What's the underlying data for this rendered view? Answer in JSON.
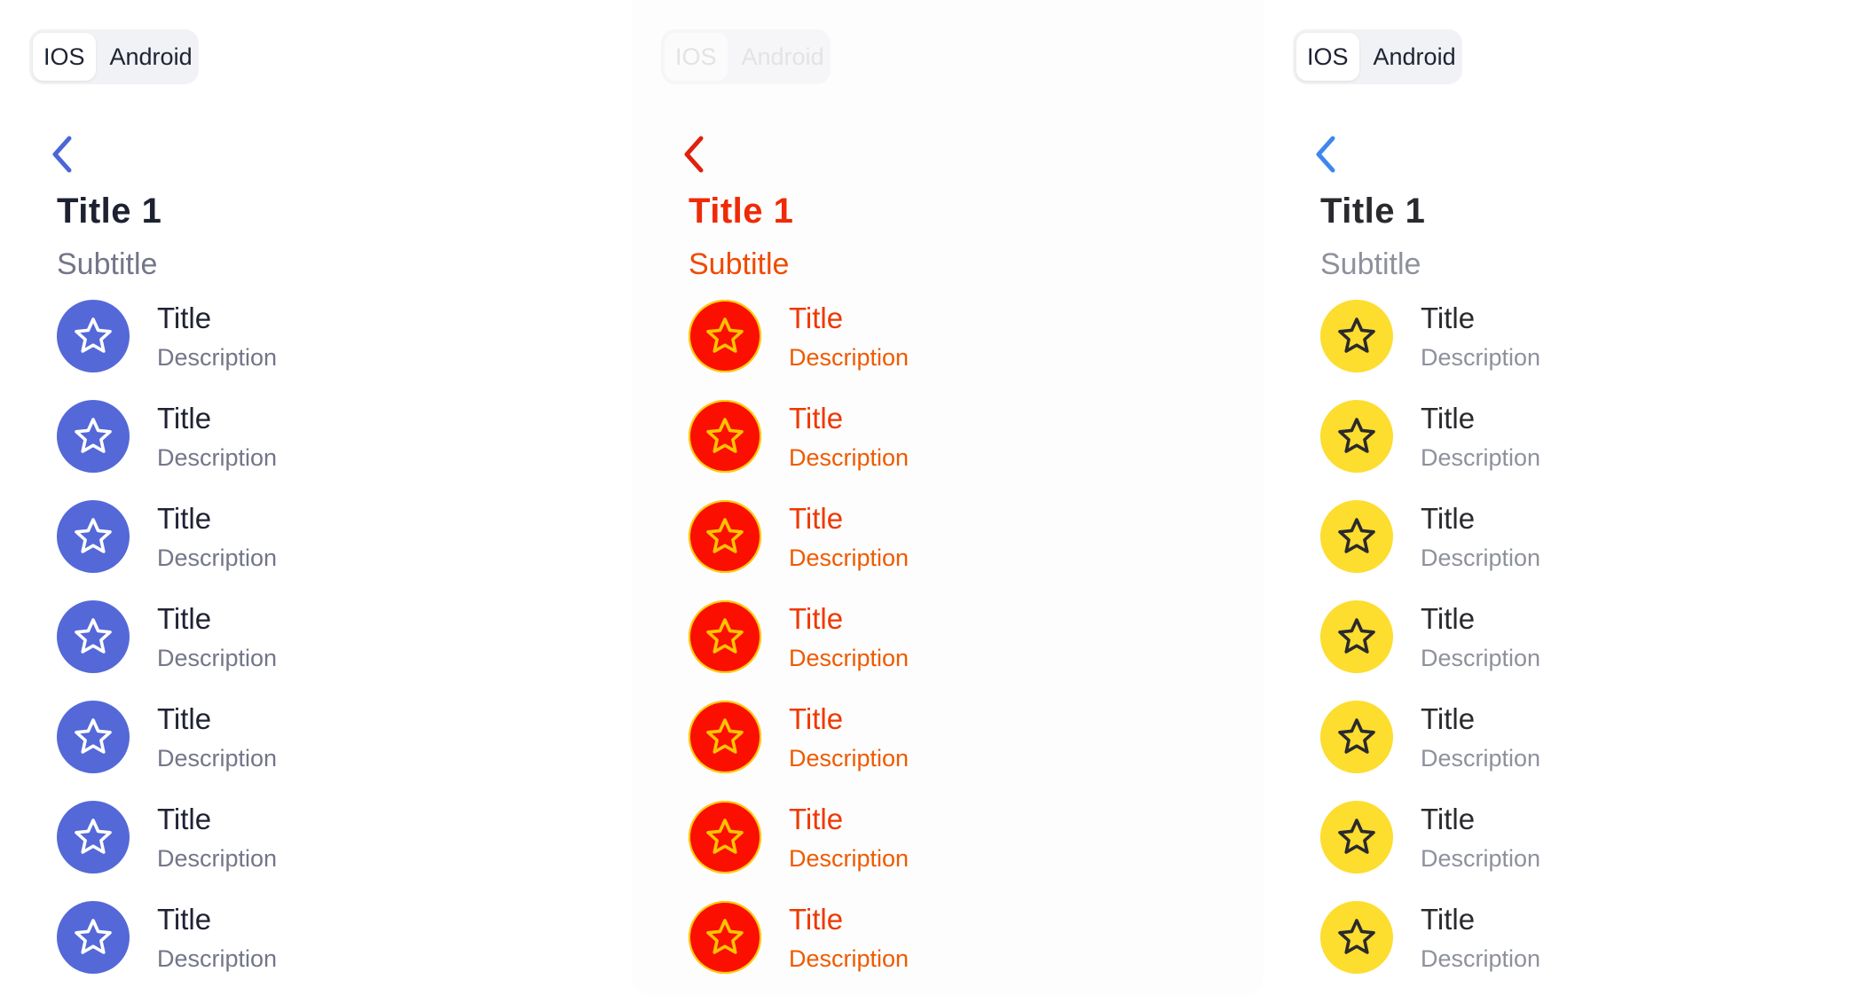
{
  "panels": [
    {
      "segmented": [
        "IOS",
        "Android"
      ],
      "header": {
        "title": "Title 1",
        "subtitle": "Subtitle"
      },
      "items": [
        {
          "title": "Title",
          "description": "Description"
        },
        {
          "title": "Title",
          "description": "Description"
        },
        {
          "title": "Title",
          "description": "Description"
        },
        {
          "title": "Title",
          "description": "Description"
        },
        {
          "title": "Title",
          "description": "Description"
        },
        {
          "title": "Title",
          "description": "Description"
        },
        {
          "title": "Title",
          "description": "Description"
        }
      ],
      "colors": {
        "accent": "#5468d8",
        "back": "#4b66d6",
        "icon": "#ffffff"
      }
    },
    {
      "segmented": [
        "IOS",
        "Android"
      ],
      "header": {
        "title": "Title 1",
        "subtitle": "Subtitle"
      },
      "items": [
        {
          "title": "Title",
          "description": "Description"
        },
        {
          "title": "Title",
          "description": "Description"
        },
        {
          "title": "Title",
          "description": "Description"
        },
        {
          "title": "Title",
          "description": "Description"
        },
        {
          "title": "Title",
          "description": "Description"
        },
        {
          "title": "Title",
          "description": "Description"
        },
        {
          "title": "Title",
          "description": "Description"
        }
      ],
      "colors": {
        "accent": "#fa0f00",
        "back": "#e0210f",
        "icon": "#ffc400"
      }
    },
    {
      "segmented": [
        "IOS",
        "Android"
      ],
      "header": {
        "title": "Title 1",
        "subtitle": "Subtitle"
      },
      "items": [
        {
          "title": "Title",
          "description": "Description"
        },
        {
          "title": "Title",
          "description": "Description"
        },
        {
          "title": "Title",
          "description": "Description"
        },
        {
          "title": "Title",
          "description": "Description"
        },
        {
          "title": "Title",
          "description": "Description"
        },
        {
          "title": "Title",
          "description": "Description"
        },
        {
          "title": "Title",
          "description": "Description"
        }
      ],
      "colors": {
        "accent": "#fddd2e",
        "back": "#3e87ec",
        "icon": "#2a2a2e"
      }
    }
  ],
  "icons": {
    "back": "chevron-left-icon",
    "item": "star-icon"
  }
}
